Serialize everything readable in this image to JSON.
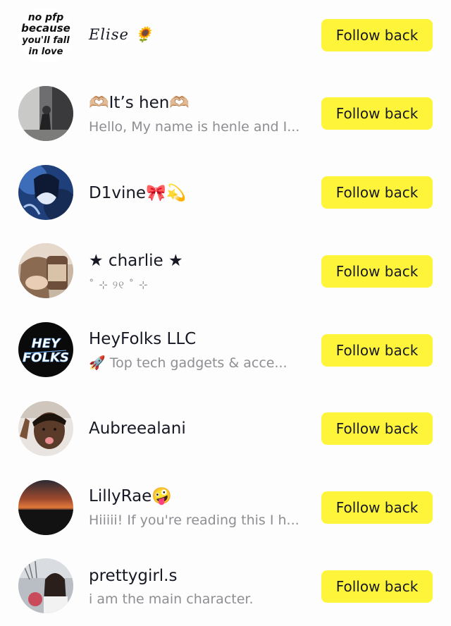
{
  "followers": [
    {
      "name": "Elise 🌻",
      "bio": "",
      "button": "Follow back",
      "avatar": "text-avatar"
    },
    {
      "name": "🫶🏼It’s hen🫶🏼",
      "bio": "Hello, My name is henle and I...",
      "button": "Follow back",
      "avatar": "photo-avatar"
    },
    {
      "name": "D1vine🎀💫",
      "bio": "",
      "button": "Follow back",
      "avatar": "photo-avatar"
    },
    {
      "name": "★ charlie ★",
      "bio": "˚ ⊹ ୨୧ ˚ ⊹",
      "button": "Follow back",
      "avatar": "photo-avatar"
    },
    {
      "name": "HeyFolks LLC",
      "bio": "🚀 Top tech gadgets & acce...",
      "button": "Follow back",
      "avatar": "logo-avatar"
    },
    {
      "name": "Aubreealani",
      "bio": "",
      "button": "Follow back",
      "avatar": "photo-avatar"
    },
    {
      "name": "LillyRae🤪",
      "bio": "Hiiiii! If you're reading this I h...",
      "button": "Follow back",
      "avatar": "photo-avatar"
    },
    {
      "name": "prettygirl.s",
      "bio": "i am the main character.",
      "button": "Follow back",
      "avatar": "photo-avatar"
    }
  ],
  "avatar_text": {
    "elise": [
      "no pfp",
      "because",
      "you'll fall",
      "in love"
    ],
    "heyfolks": [
      "HEY",
      "FOLKS"
    ]
  },
  "colors": {
    "button_bg": "#fef53b",
    "primary_text": "#161823",
    "secondary_text": "#8e8e93",
    "background": "#fdfdfd"
  }
}
